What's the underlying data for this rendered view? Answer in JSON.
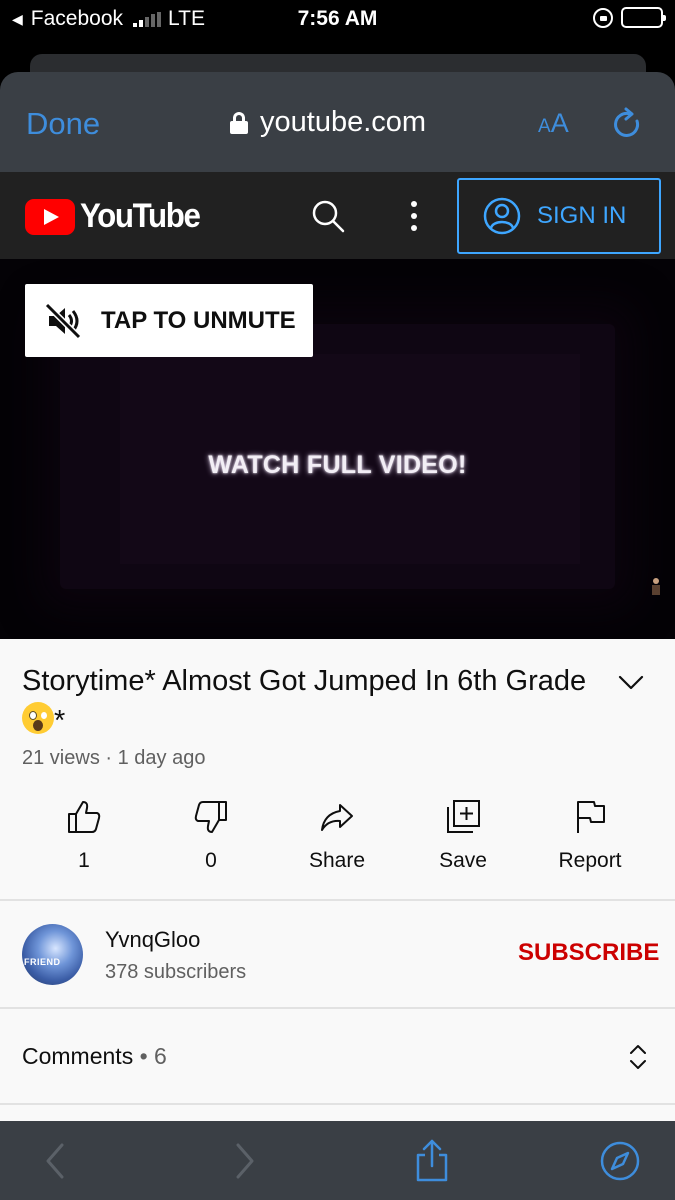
{
  "status_bar": {
    "back_app": "Facebook",
    "network": "LTE",
    "time": "7:56 AM",
    "signal_bars": 2
  },
  "safari": {
    "done_label": "Done",
    "url": "youtube.com",
    "text_size_small": "A",
    "text_size_large": "A",
    "accent_color": "#3e8ddc"
  },
  "youtube_bar": {
    "logo_text": "YouTube",
    "sign_in_label": "SIGN IN",
    "accent_color": "#3ea6ff"
  },
  "video": {
    "unmute_label": "TAP TO UNMUTE",
    "overlay_text": "WATCH FULL VIDEO!"
  },
  "video_info": {
    "title": "Storytime* Almost Got Jumped In 6th Grade",
    "title_suffix": "*",
    "emoji": "face-screaming-in-fear",
    "meta": "21 views · 1 day ago"
  },
  "actions": [
    {
      "icon": "thumbs-up-icon",
      "label": "1"
    },
    {
      "icon": "thumbs-down-icon",
      "label": "0"
    },
    {
      "icon": "share-icon",
      "label": "Share"
    },
    {
      "icon": "save-icon",
      "label": "Save"
    },
    {
      "icon": "flag-icon",
      "label": "Report"
    }
  ],
  "channel": {
    "name": "YvnqGloo",
    "subscribers": "378 subscribers",
    "subscribe_label": "SUBSCRIBE",
    "subscribe_color": "#cc0000",
    "avatar_text": "FRIEND"
  },
  "comments": {
    "label": "Comments",
    "separator": " • ",
    "count": "6"
  }
}
